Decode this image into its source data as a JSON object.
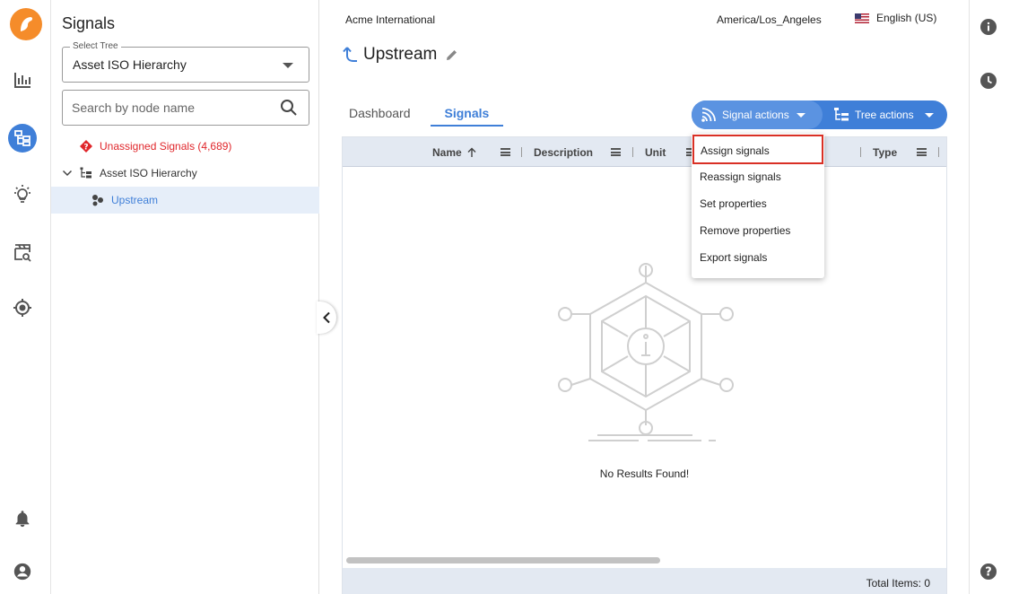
{
  "rail": {
    "items": [
      {
        "id": "analytics",
        "icon": "bar-chart-icon"
      },
      {
        "id": "trees",
        "icon": "hierarchy-icon",
        "active": true
      },
      {
        "id": "insights",
        "icon": "lightbulb-icon"
      },
      {
        "id": "investigate",
        "icon": "clapper-search-icon"
      },
      {
        "id": "target",
        "icon": "target-icon"
      }
    ],
    "bottom": [
      {
        "id": "notifications",
        "icon": "bell-icon"
      },
      {
        "id": "account",
        "icon": "user-circle-icon"
      }
    ]
  },
  "tree_panel": {
    "title": "Signals",
    "select_tree": {
      "legend": "Select Tree",
      "value": "Asset ISO Hierarchy"
    },
    "search": {
      "placeholder": "Search by node name"
    },
    "nodes": {
      "unassigned": "Unassigned Signals (4,689)",
      "root": "Asset ISO Hierarchy",
      "child": "Upstream"
    }
  },
  "header": {
    "org": "Acme International",
    "timezone": "America/Los_Angeles",
    "language": "English (US)"
  },
  "page": {
    "title": "Upstream"
  },
  "tabs": [
    {
      "label": "Dashboard",
      "active": false
    },
    {
      "label": "Signals",
      "active": true
    }
  ],
  "actions": {
    "signal_actions": "Signal actions",
    "tree_actions": "Tree actions"
  },
  "grid": {
    "columns": [
      "Name",
      "Description",
      "Unit",
      "Type"
    ],
    "empty_text": "No Results Found!",
    "footer": "Total Items: 0"
  },
  "signal_menu": {
    "items": [
      "Assign signals",
      "Reassign signals",
      "Set properties",
      "Remove properties",
      "Export signals"
    ],
    "highlighted": "Assign signals"
  },
  "colors": {
    "accent": "#3f7fd8",
    "brand_orange": "#f58c2a",
    "error_red": "#e0262b",
    "highlight_border": "#d93025"
  }
}
